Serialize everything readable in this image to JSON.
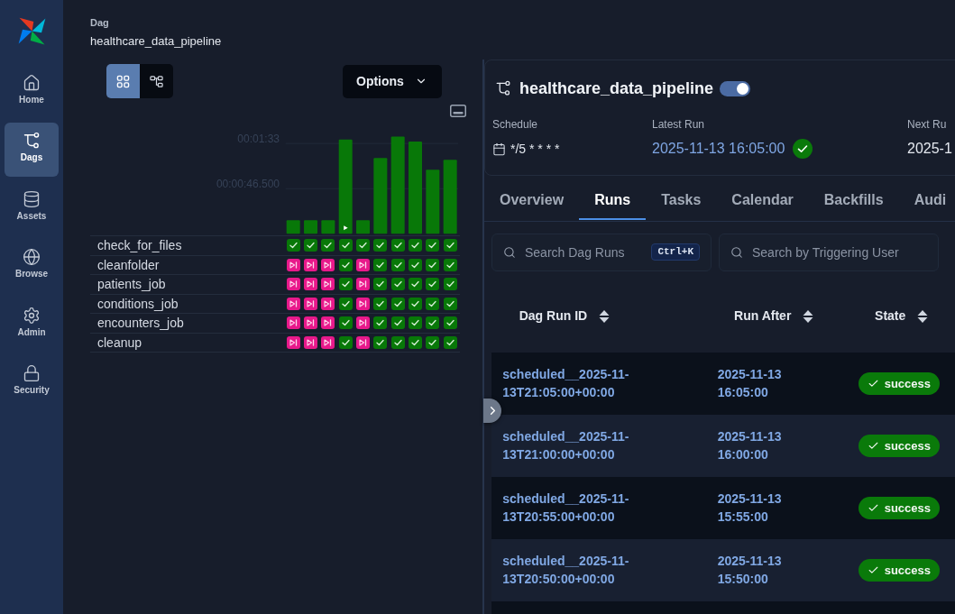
{
  "sidebar": {
    "items": [
      {
        "label": "Home",
        "selected": false
      },
      {
        "label": "Dags",
        "selected": true
      },
      {
        "label": "Assets",
        "selected": false
      },
      {
        "label": "Browse",
        "selected": false
      },
      {
        "label": "Admin",
        "selected": false
      },
      {
        "label": "Security",
        "selected": false
      }
    ]
  },
  "dag_header": {
    "label": "Dag",
    "name": "healthcare_data_pipeline"
  },
  "view_toggle": [
    {
      "selected": true
    },
    {
      "selected": false
    }
  ],
  "options_button": {
    "label": "Options"
  },
  "duration_chart": {
    "gridline_labels": [
      "00:01:33",
      "00:00:46.500"
    ],
    "runs": [
      {
        "play_marker": false
      },
      {
        "play_marker": false
      },
      {
        "play_marker": false
      },
      {
        "play_marker": true
      },
      {
        "play_marker": false
      },
      {
        "play_marker": false
      },
      {
        "play_marker": false
      },
      {
        "play_marker": false
      },
      {
        "play_marker": false
      },
      {
        "play_marker": false
      }
    ]
  },
  "tasks": [
    {
      "name": "check_for_files",
      "instances": [
        {
          "kind": "success"
        },
        {
          "kind": "success"
        },
        {
          "kind": "success"
        },
        {
          "kind": "success"
        },
        {
          "kind": "success"
        },
        {
          "kind": "success"
        },
        {
          "kind": "success"
        },
        {
          "kind": "success"
        },
        {
          "kind": "success"
        },
        {
          "kind": "success"
        }
      ]
    },
    {
      "name": "cleanfolder",
      "instances": [
        {
          "kind": "skipped"
        },
        {
          "kind": "skipped"
        },
        {
          "kind": "skipped"
        },
        {
          "kind": "success"
        },
        {
          "kind": "skipped"
        },
        {
          "kind": "success"
        },
        {
          "kind": "success"
        },
        {
          "kind": "success"
        },
        {
          "kind": "success"
        },
        {
          "kind": "success"
        }
      ]
    },
    {
      "name": "patients_job",
      "instances": [
        {
          "kind": "skipped"
        },
        {
          "kind": "skipped"
        },
        {
          "kind": "skipped"
        },
        {
          "kind": "success"
        },
        {
          "kind": "skipped"
        },
        {
          "kind": "success"
        },
        {
          "kind": "success"
        },
        {
          "kind": "success"
        },
        {
          "kind": "success"
        },
        {
          "kind": "success"
        }
      ]
    },
    {
      "name": "conditions_job",
      "instances": [
        {
          "kind": "skipped"
        },
        {
          "kind": "skipped"
        },
        {
          "kind": "skipped"
        },
        {
          "kind": "success"
        },
        {
          "kind": "skipped"
        },
        {
          "kind": "success"
        },
        {
          "kind": "success"
        },
        {
          "kind": "success"
        },
        {
          "kind": "success"
        },
        {
          "kind": "success"
        }
      ]
    },
    {
      "name": "encounters_job",
      "instances": [
        {
          "kind": "skipped"
        },
        {
          "kind": "skipped"
        },
        {
          "kind": "skipped"
        },
        {
          "kind": "success"
        },
        {
          "kind": "skipped"
        },
        {
          "kind": "success"
        },
        {
          "kind": "success"
        },
        {
          "kind": "success"
        },
        {
          "kind": "success"
        },
        {
          "kind": "success"
        }
      ]
    },
    {
      "name": "cleanup",
      "instances": [
        {
          "kind": "skipped"
        },
        {
          "kind": "skipped"
        },
        {
          "kind": "skipped"
        },
        {
          "kind": "success"
        },
        {
          "kind": "skipped"
        },
        {
          "kind": "success"
        },
        {
          "kind": "success"
        },
        {
          "kind": "success"
        },
        {
          "kind": "success"
        },
        {
          "kind": "success"
        }
      ]
    }
  ],
  "dag_details": {
    "title": "healthcare_data_pipeline",
    "enabled": true,
    "fields": [
      {
        "kind": "schedule",
        "label": "Schedule",
        "value": "*/5 * * * *"
      },
      {
        "kind": "run",
        "label": "Latest Run",
        "value": "2025-11-13 16:05:00",
        "status": {
          "kind": "success"
        }
      },
      {
        "kind": "plain",
        "label": "Next Ru",
        "value": "2025-1"
      }
    ]
  },
  "tabs": [
    {
      "label": "Overview",
      "selected": false
    },
    {
      "label": "Runs",
      "selected": true
    },
    {
      "label": "Tasks",
      "selected": false
    },
    {
      "label": "Calendar",
      "selected": false
    },
    {
      "label": "Backfills",
      "selected": false
    },
    {
      "label": "Audi",
      "selected": false
    }
  ],
  "search_fields": [
    {
      "placeholder": "Search Dag Runs",
      "shortcut": "Ctrl+K"
    },
    {
      "placeholder": "Search by Triggering User"
    }
  ],
  "runs_table": {
    "columns": [
      {
        "label": "Dag Run ID",
        "sortable": true
      },
      {
        "label": "Run After",
        "sortable": true
      },
      {
        "label": "State",
        "sortable": true
      }
    ],
    "rows": [
      {
        "run_id": "scheduled__2025-11-13T21:05:00+00:00",
        "run_after": "2025-11-13 16:05:00",
        "state": {
          "kind": "success",
          "label": "success"
        }
      },
      {
        "run_id": "scheduled__2025-11-13T21:00:00+00:00",
        "run_after": "2025-11-13 16:00:00",
        "state": {
          "kind": "success",
          "label": "success"
        }
      },
      {
        "run_id": "scheduled__2025-11-13T20:55:00+00:00",
        "run_after": "2025-11-13 15:55:00",
        "state": {
          "kind": "success",
          "label": "success"
        }
      },
      {
        "run_id": "scheduled__2025-11-13T20:50:00+00:00",
        "run_after": "2025-11-13 15:50:00",
        "state": {
          "kind": "success",
          "label": "success"
        }
      }
    ]
  }
}
